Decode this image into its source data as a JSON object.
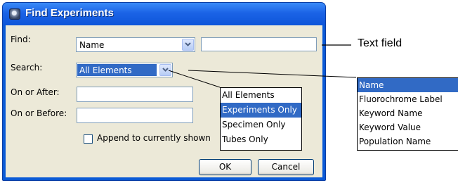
{
  "dialog": {
    "title": "Find Experiments",
    "find_label": "Find:",
    "find_value": "Name",
    "text_value": "",
    "search_label": "Search:",
    "search_value": "All Elements",
    "on_after_label": "On or After:",
    "on_after_value": "",
    "on_before_label": "On or Before:",
    "on_before_value": "",
    "append_label": "Append to currently shown",
    "append_checked": false,
    "ok_label": "OK",
    "cancel_label": "Cancel"
  },
  "search_options": [
    "All Elements",
    "Experiments Only",
    "Specimen Only",
    "Tubes Only"
  ],
  "search_selected": "Experiments Only",
  "find_options": [
    "Name",
    "Fluorochrome Label",
    "Keyword Name",
    "Keyword Value",
    "Population Name"
  ],
  "find_selected": "Name",
  "callout": {
    "text_field": "Text field"
  },
  "colors": {
    "selection": "#316ac5",
    "titlebar": "#0b5ad6",
    "dialog_bg": "#ece9d8"
  }
}
